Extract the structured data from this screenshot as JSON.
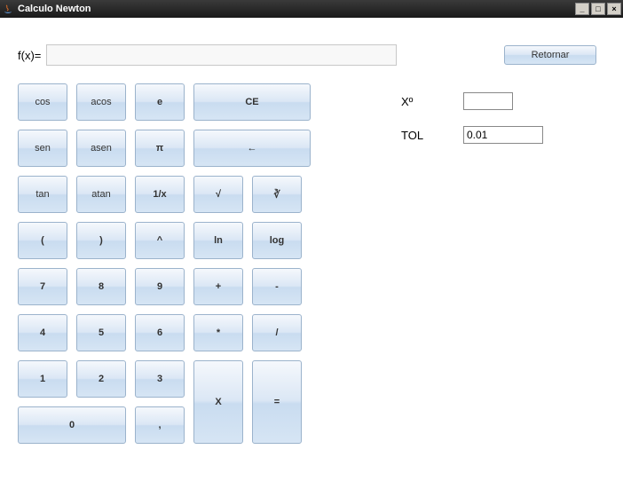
{
  "window": {
    "title": "Calculo Newton"
  },
  "form": {
    "fx_label": "f(x)=",
    "fx_value": "",
    "retornar_label": "Retornar",
    "x0_label": "Xº",
    "x0_value": "",
    "tol_label": "TOL",
    "tol_value": "0.01"
  },
  "buttons": {
    "cos": "cos",
    "acos": "acos",
    "e": "e",
    "ce": "CE",
    "sen": "sen",
    "asen": "asen",
    "pi": "π",
    "back": "←",
    "tan": "tan",
    "atan": "atan",
    "inv": "1/x",
    "sqrt": "√",
    "cbrt": "∛",
    "lparen": "(",
    "rparen": ")",
    "pow": "^",
    "ln": "ln",
    "log": "log",
    "n7": "7",
    "n8": "8",
    "n9": "9",
    "plus": "+",
    "minus": "-",
    "n4": "4",
    "n5": "5",
    "n6": "6",
    "mult": "*",
    "div": "/",
    "n1": "1",
    "n2": "2",
    "n3": "3",
    "x": "X",
    "eq": "=",
    "n0": "0",
    "comma": ","
  }
}
